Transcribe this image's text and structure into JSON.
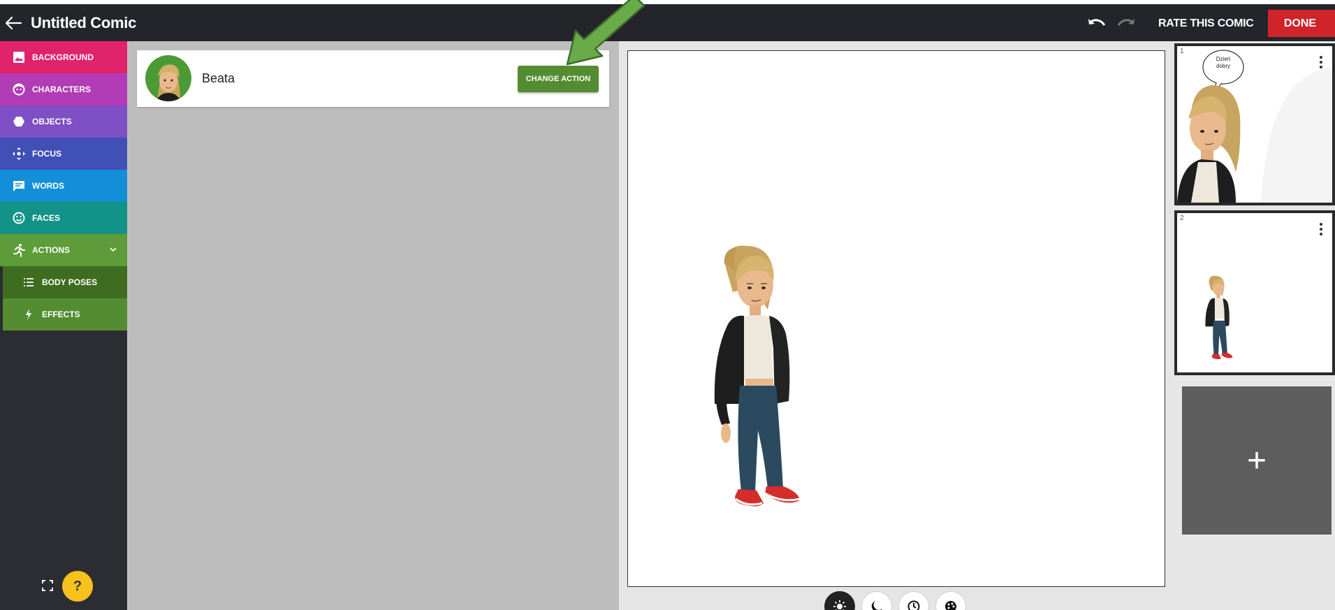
{
  "app": {
    "title": "Untitled Comic",
    "rate_label": "RATE THIS COMIC",
    "done_label": "DONE"
  },
  "sidebar": {
    "items": [
      {
        "label": "BACKGROUND",
        "icon": "image-icon",
        "color": "#e0236a"
      },
      {
        "label": "CHARACTERS",
        "icon": "face-icon",
        "color": "#b13cb5"
      },
      {
        "label": "OBJECTS",
        "icon": "hexagon-icon",
        "color": "#7e4fc5"
      },
      {
        "label": "FOCUS",
        "icon": "move-icon",
        "color": "#4150b7"
      },
      {
        "label": "WORDS",
        "icon": "speech-icon",
        "color": "#128fd8"
      },
      {
        "label": "FACES",
        "icon": "smile-icon",
        "color": "#139288"
      },
      {
        "label": "ACTIONS",
        "icon": "run-icon",
        "color": "#5d9c38",
        "expanded": true
      }
    ],
    "subitems": [
      {
        "label": "BODY POSES",
        "icon": "list-icon",
        "color": "#3e6d20"
      },
      {
        "label": "EFFECTS",
        "icon": "bolt-icon",
        "color": "#548d31"
      }
    ],
    "help_label": "?"
  },
  "character": {
    "name": "Beata",
    "action_label": "CHANGE ACTION"
  },
  "panels": [
    {
      "number": "1",
      "bubble_text": "Dzień dobry"
    },
    {
      "number": "2"
    }
  ],
  "add_panel_label": "+"
}
